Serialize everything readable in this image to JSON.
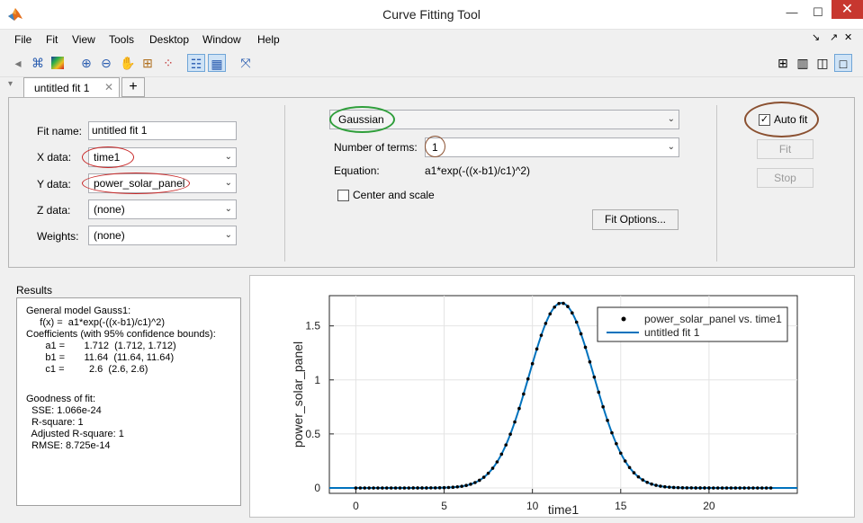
{
  "window": {
    "title": "Curve Fitting Tool",
    "minimize": "—",
    "maximize": "☐",
    "close": "✕"
  },
  "menubar": [
    "File",
    "Fit",
    "View",
    "Tools",
    "Desktop",
    "Window",
    "Help"
  ],
  "tabs": [
    {
      "label": "untitled fit 1",
      "close": "✕"
    }
  ],
  "tab_add": "+",
  "fit_panel": {
    "fit_name_label": "Fit name:",
    "fit_name_value": "untitled fit 1",
    "x_data_label": "X data:",
    "x_data_value": "time1",
    "y_data_label": "Y data:",
    "y_data_value": "power_solar_panel",
    "z_data_label": "Z data:",
    "z_data_value": "(none)",
    "weights_label": "Weights:",
    "weights_value": "(none)",
    "model_type": "Gaussian",
    "num_terms_label": "Number of terms:",
    "num_terms_value": "1",
    "equation_label": "Equation:",
    "equation_value": "a1*exp(-((x-b1)/c1)^2)",
    "center_scale_label": "Center and scale",
    "center_scale_checked": false,
    "fit_options_label": "Fit Options...",
    "auto_fit_label": "Auto fit",
    "auto_fit_checked": true,
    "fit_button": "Fit",
    "stop_button": "Stop"
  },
  "results": {
    "title": "Results",
    "lines": [
      "General model Gauss1:",
      "     f(x) =  a1*exp(-((x-b1)/c1)^2)",
      "Coefficients (with 95% confidence bounds):",
      "       a1 =       1.712  (1.712, 1.712)",
      "       b1 =       11.64  (11.64, 11.64)",
      "       c1 =         2.6  (2.6, 2.6)",
      "",
      "Goodness of fit:",
      "  SSE: 1.066e-24",
      "  R-square: 1",
      "  Adjusted R-square: 1",
      "  RMSE: 8.725e-14"
    ]
  },
  "chart_data": {
    "type": "scatter",
    "xlabel": "time1",
    "ylabel": "power_solar_panel",
    "xlim": [
      -1.5,
      25
    ],
    "ylim": [
      -0.05,
      1.78
    ],
    "xticks": [
      0,
      5,
      10,
      15,
      20
    ],
    "yticks": [
      0,
      0.5,
      1,
      1.5
    ],
    "xtick_labels": [
      "0",
      "5",
      "10",
      "15",
      "20"
    ],
    "ytick_labels": [
      "0",
      "0.5",
      "1",
      "1.5"
    ],
    "grid": true,
    "legend_position": "top-right",
    "series": [
      {
        "name": "power_solar_panel vs. time1",
        "kind": "points",
        "x_start": 0,
        "x_end": 23.7,
        "x_step": 0.25,
        "a1": 1.712,
        "b1": 11.64,
        "c1": 2.6,
        "color": "#000000"
      },
      {
        "name": "untitled fit 1",
        "kind": "line",
        "a1": 1.712,
        "b1": 11.64,
        "c1": 2.6,
        "color": "#0072bd"
      }
    ]
  },
  "colors": {
    "accent_green": "#2e9e3a",
    "accent_brown": "#8a5030",
    "accent_red": "#c82828",
    "fit_line": "#0072bd"
  }
}
